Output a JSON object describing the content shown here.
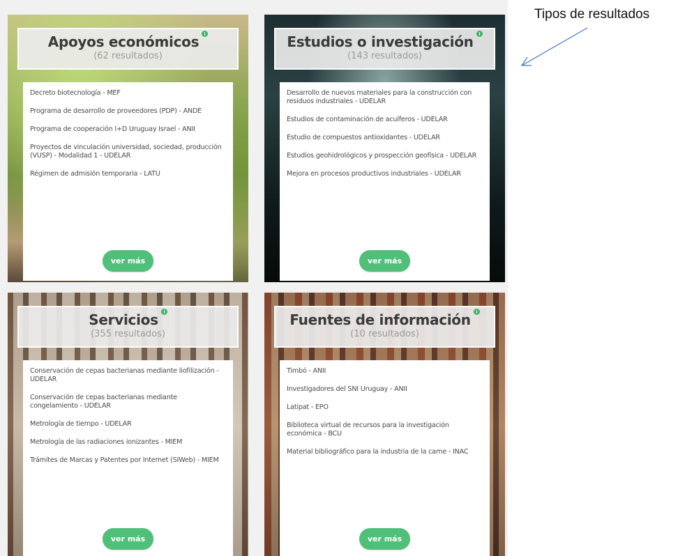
{
  "annotation": {
    "label": "Tipos de resultados"
  },
  "colors": {
    "accent_green": "#4fbf7a",
    "annotation_arrow": "#4a74c9"
  },
  "cards": [
    {
      "title": "Apoyos económicos",
      "count": "(62 resultados)",
      "items": [
        "Decreto biotecnología - MEF",
        "Programa de desarrollo de proveedores (PDP) - ANDE",
        "Programa de cooperación I+D Uruguay Israel - ANII",
        "Proyectos de vinculación universidad, sociedad, producción (VUSP) - Modalidad 1 - UDELAR",
        "Régimen de admisión temporaria - LATU"
      ],
      "button_label": "ver más"
    },
    {
      "title": "Estudios o investigación",
      "count": "(143 resultados)",
      "items": [
        "Desarrollo de nuevos materiales para la construcción con residuos industriales - UDELAR",
        "Estudios de contaminación de acuíferos - UDELAR",
        "Estudio de compuestos antioxidantes - UDELAR",
        "Estudios geohidrológicos y prospección geofísica - UDELAR",
        "Mejora en procesos productivos industriales - UDELAR"
      ],
      "button_label": "ver más"
    },
    {
      "title": "Servicios",
      "count": "(355 resultados)",
      "items": [
        "Conservación de cepas bacterianas mediante liofilización - UDELAR",
        "Conservación de cepas bacterianas mediante congelamiento - UDELAR",
        "Metrología de tiempo - UDELAR",
        "Metrología de las radiaciones ionizantes - MIEM",
        "Trámites de Marcas y Patentes por Internet (SIWeb) - MIEM"
      ],
      "button_label": "ver más"
    },
    {
      "title": "Fuentes de información",
      "count": "(10 resultados)",
      "items": [
        "Timbó - ANII",
        "Investigadores del SNI Uruguay - ANII",
        "Latipat - EPO",
        "Biblioteca virtual de recursos para la investigación económica - BCU",
        "Material bibliográfico para la industria de la carne - INAC"
      ],
      "button_label": "ver más"
    }
  ]
}
